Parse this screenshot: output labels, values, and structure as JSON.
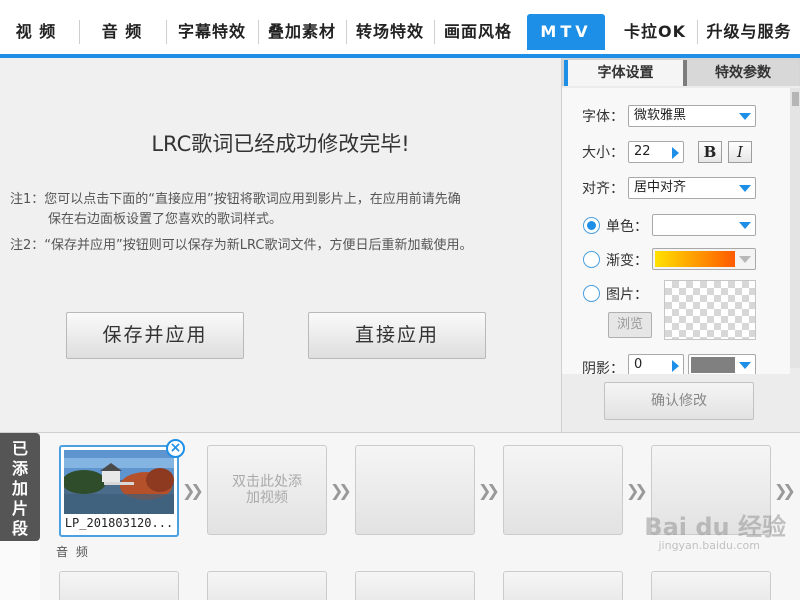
{
  "tabs": [
    {
      "label": "视 频"
    },
    {
      "label": "音 频"
    },
    {
      "label": "字幕特效"
    },
    {
      "label": "叠加素材"
    },
    {
      "label": "转场特效"
    },
    {
      "label": "画面风格"
    },
    {
      "label": "MTV",
      "active": true
    },
    {
      "label": "卡拉OK"
    },
    {
      "label": "升级与服务"
    }
  ],
  "main": {
    "title": "LRC歌词已经成功修改完毕!",
    "note1_label": "注1：",
    "note1_line1": "您可以点击下面的“直接应用”按钮将歌词应用到影片上，在应用前请先确",
    "note1_line2": "保在右边面板设置了您喜欢的歌词样式。",
    "note2_label": "注2：",
    "note2_text": "“保存并应用”按钮则可以保存为新LRC歌词文件，方便日后重新加载使用。",
    "save_apply_label": "保存并应用",
    "apply_label": "直接应用"
  },
  "settings": {
    "tab_font": "字体设置",
    "tab_effect": "特效参数",
    "font_label": "字体：",
    "font_value": "微软雅黑",
    "size_label": "大小：",
    "size_value": "22",
    "bold_label": "B",
    "italic_label": "I",
    "align_label": "对齐：",
    "align_value": "居中对齐",
    "single_color_label": "单色：",
    "gradient_label": "渐变：",
    "image_label": "图片：",
    "browse_label": "浏览",
    "shadow_label": "阴影：",
    "shadow_value": "0",
    "confirm_label": "确认修改",
    "colors": {
      "accent": "#1e8fe6",
      "gradient_start": "#ffe100",
      "gradient_end": "#ff5a00",
      "shadow_color": "#808080"
    }
  },
  "clips": {
    "side_label": "已添加片段",
    "first_clip_name": "LP_201803120...",
    "placeholder_text": "双击此处添加视频",
    "audio_label": "音 频"
  },
  "watermark": {
    "text": "Bai du 经验",
    "sub": "jingyan.baidu.com"
  }
}
